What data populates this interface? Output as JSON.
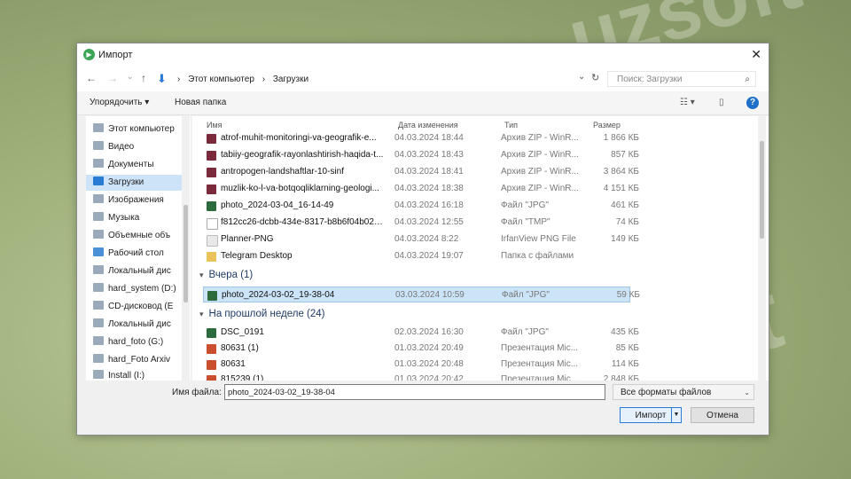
{
  "dialog": {
    "title": "Импорт",
    "close": "✕"
  },
  "nav": {
    "back": "←",
    "forward": "→",
    "recent": "⌄",
    "up": "↑"
  },
  "address": {
    "segments": [
      "Этот компьютер",
      "Загрузки"
    ],
    "sep": "›",
    "dropdown": "⌄",
    "refresh": "↻"
  },
  "search": {
    "placeholder": "Поиск: Загрузки",
    "icon": "⌕"
  },
  "toolbar": {
    "organize": "Упорядочить ▾",
    "new_folder": "Новая папка",
    "view": "☷ ▾",
    "pane": "▯",
    "help": "?"
  },
  "sidebar": {
    "items": [
      {
        "label": "Этот компьютер",
        "icon": "computer-icon"
      },
      {
        "label": "Видео",
        "icon": "video-icon"
      },
      {
        "label": "Документы",
        "icon": "documents-icon"
      },
      {
        "label": "Загрузки",
        "icon": "downloads-icon"
      },
      {
        "label": "Изображения",
        "icon": "pictures-icon"
      },
      {
        "label": "Музыка",
        "icon": "music-icon"
      },
      {
        "label": "Объемные объ",
        "icon": "objects-3d-icon"
      },
      {
        "label": "Рабочий стол",
        "icon": "desktop-icon"
      },
      {
        "label": "Локальный дис",
        "icon": "drive-icon"
      },
      {
        "label": "hard_system (D:)",
        "icon": "drive-icon"
      },
      {
        "label": "CD-дисковод (E",
        "icon": "cd-drive-icon"
      },
      {
        "label": "Локальный дис",
        "icon": "drive-icon"
      },
      {
        "label": "hard_foto (G:)",
        "icon": "drive-icon"
      },
      {
        "label": "hard_Foto Arxiv",
        "icon": "drive-icon"
      },
      {
        "label": "Install (I:)",
        "icon": "drive-icon"
      }
    ]
  },
  "columns": {
    "name": "Имя",
    "date": "Дата изменения",
    "type": "Тип",
    "size": "Размер",
    "sort_arrow": "^"
  },
  "files_today": [
    {
      "name": "atrof-muhit-monitoringi-va-geografik-e...",
      "date": "04.03.2024 18:44",
      "type": "Архив ZIP - WinR...",
      "size": "1 866 КБ",
      "icon": "winrar-icon"
    },
    {
      "name": "tabiiy-geografik-rayonlashtirish-haqida-t...",
      "date": "04.03.2024 18:43",
      "type": "Архив ZIP - WinR...",
      "size": "857 КБ",
      "icon": "winrar-icon"
    },
    {
      "name": "antropogen-landshaftlar-10-sinf",
      "date": "04.03.2024 18:41",
      "type": "Архив ZIP - WinR...",
      "size": "3 864 КБ",
      "icon": "winrar-icon"
    },
    {
      "name": "muzlik-ko-l-va-botqoqliklarning-geologi...",
      "date": "04.03.2024 18:38",
      "type": "Архив ZIP - WinR...",
      "size": "4 151 КБ",
      "icon": "winrar-icon"
    },
    {
      "name": "photo_2024-03-04_16-14-49",
      "date": "04.03.2024 16:18",
      "type": "Файл \"JPG\"",
      "size": "461 КБ",
      "icon": "image-icon"
    },
    {
      "name": "f812cc26-dcbb-434e-8317-b8b6f04b02b1...",
      "date": "04.03.2024 12:55",
      "type": "Файл \"TMP\"",
      "size": "74 КБ",
      "icon": "file-icon"
    },
    {
      "name": "Planner-PNG",
      "date": "04.03.2024 8:22",
      "type": "IrfanView PNG File",
      "size": "149 КБ",
      "icon": "png-icon"
    },
    {
      "name": "Telegram Desktop",
      "date": "04.03.2024 19:07",
      "type": "Папка с файлами",
      "size": "",
      "icon": "folder-icon"
    }
  ],
  "group_yesterday": "Вчера (1)",
  "files_yesterday": [
    {
      "name": "photo_2024-03-02_19-38-04",
      "date": "03.03.2024 10:59",
      "type": "Файл \"JPG\"",
      "size": "59 КБ",
      "icon": "image-icon"
    }
  ],
  "group_last_week": "На прошлой неделе (24)",
  "files_last_week": [
    {
      "name": "DSC_0191",
      "date": "02.03.2024 16:30",
      "type": "Файл \"JPG\"",
      "size": "435 КБ",
      "icon": "image-icon"
    },
    {
      "name": "80631 (1)",
      "date": "01.03.2024 20:49",
      "type": "Презентация Mic...",
      "size": "85 КБ",
      "icon": "powerpoint-icon"
    },
    {
      "name": "80631",
      "date": "01.03.2024 20:48",
      "type": "Презентация Mic...",
      "size": "114 КБ",
      "icon": "powerpoint-icon"
    },
    {
      "name": "815239 (1)",
      "date": "01.03.2024 20:42",
      "type": "Презентация Mic...",
      "size": "2 848 КБ",
      "icon": "powerpoint-icon"
    }
  ],
  "filename": {
    "label": "Имя файла:",
    "value": "photo_2024-03-02_19-38-04",
    "dropdown": "⌄"
  },
  "filter": {
    "value": "Все форматы файлов",
    "dropdown": "⌄"
  },
  "buttons": {
    "import": "Импорт",
    "import_split": "▼",
    "cancel": "Отмена"
  },
  "watermark": [
    "uzsoft",
    "uzsoft",
    "uzsoft"
  ],
  "colors": {
    "accent": "#2a7bd4",
    "selected": "#cce4f7",
    "winrar": "#7a2a3a",
    "powerpoint": "#c94f2e",
    "folder": "#e9c35a",
    "image": "#2e6b3c"
  }
}
